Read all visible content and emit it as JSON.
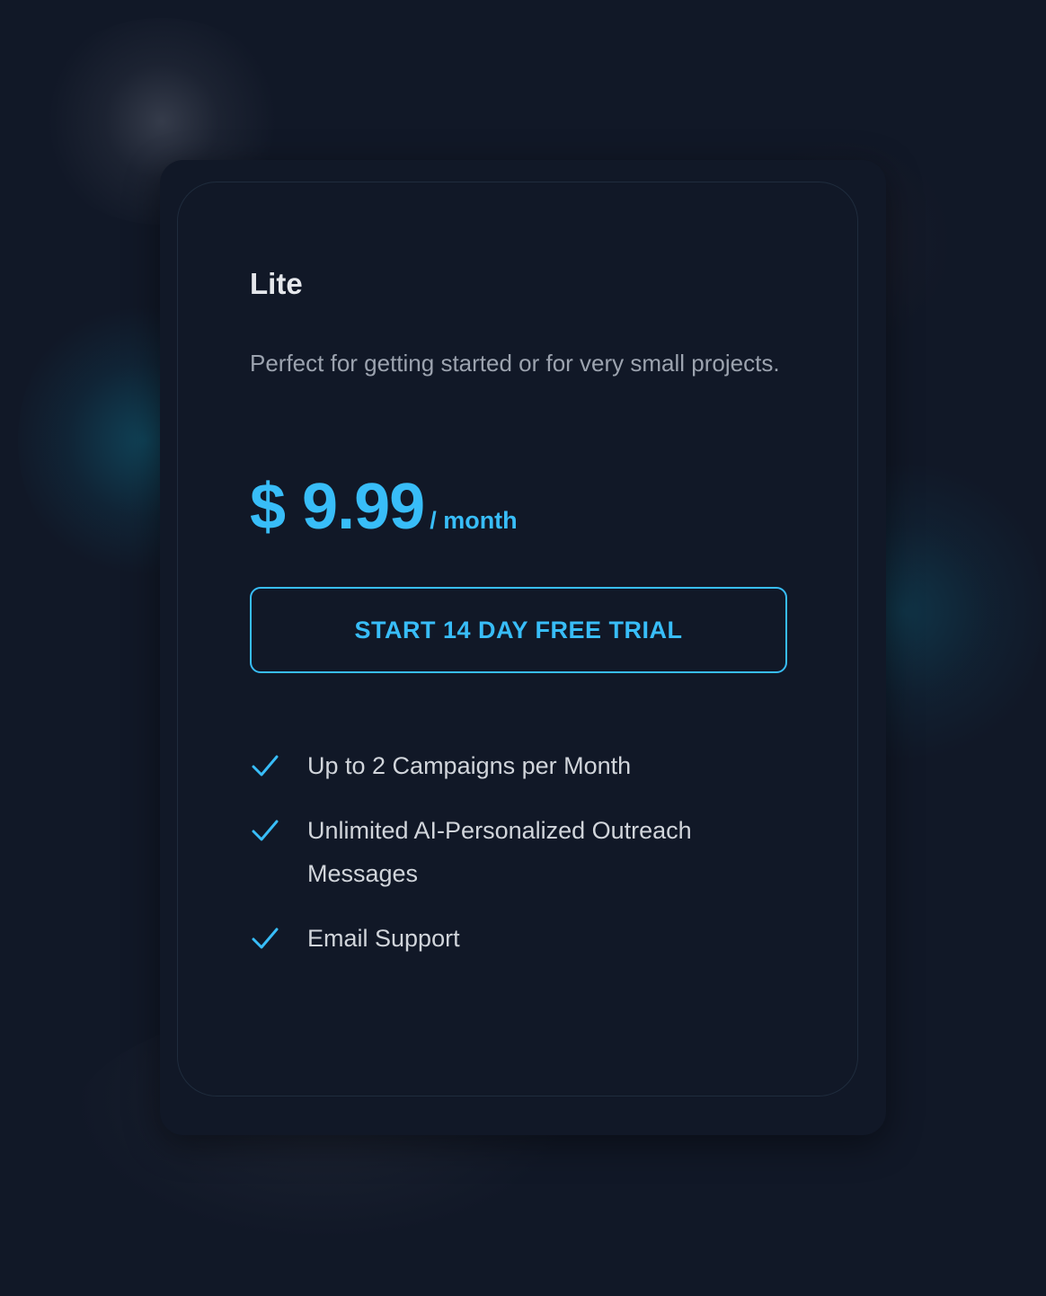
{
  "plan": {
    "name": "Lite",
    "description": "Perfect for getting started or for very small projects.",
    "price": "$ 9.99",
    "period": "/ month",
    "cta_label": "START 14 DAY FREE TRIAL"
  },
  "features": [
    {
      "icon": "check-icon",
      "text": "Up to 2 Campaigns per Month"
    },
    {
      "icon": "check-icon",
      "text": "Unlimited AI-Personalized Outreach Messages"
    },
    {
      "icon": "check-icon",
      "text": "Email Support"
    }
  ],
  "colors": {
    "background": "#111827",
    "accent": "#38bdf8",
    "heading": "#e5e7eb",
    "muted": "#9ca3af",
    "feature_text": "#d1d5db"
  }
}
